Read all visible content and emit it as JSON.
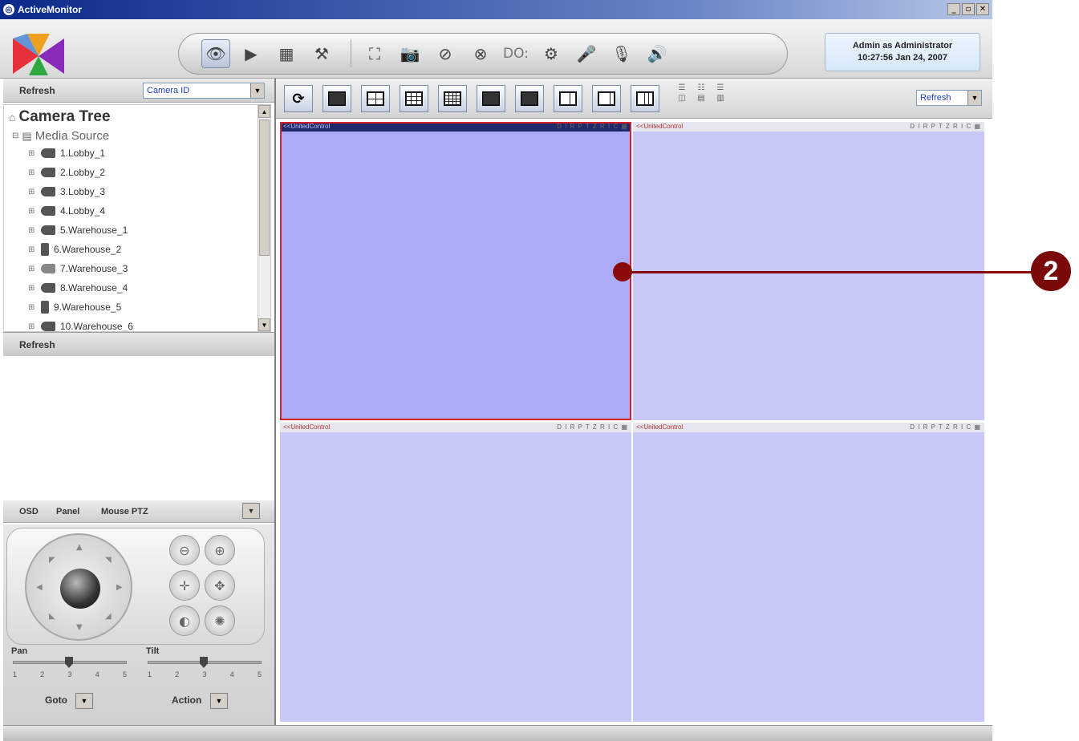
{
  "window": {
    "title": "ActiveMonitor",
    "controls": [
      "_",
      "▫",
      "✕"
    ]
  },
  "user": {
    "line1": "Admin as Administrator",
    "line2": "10:27:56 Jan 24, 2007"
  },
  "toolbar": {
    "do_label": "DO:"
  },
  "left": {
    "refresh_label": "Refresh",
    "camera_combo": "Camera ID",
    "tree_title": "Camera Tree",
    "tree_root": "Media Source",
    "cameras": [
      "1.Lobby_1",
      "2.Lobby_2",
      "3.Lobby_3",
      "4.Lobby_4",
      "5.Warehouse_1",
      "6.Warehouse_2",
      "7.Warehouse_3",
      "8.Warehouse_4",
      "9.Warehouse_5",
      "10.Warehouse_6"
    ],
    "refresh_bottom": "Refresh"
  },
  "ptz": {
    "tabs": [
      "OSD",
      "Panel",
      "Mouse PTZ"
    ],
    "pan_label": "Pan",
    "tilt_label": "Tilt",
    "ticks": [
      "1",
      "2",
      "3",
      "4",
      "5"
    ],
    "goto_label": "Goto",
    "action_label": "Action"
  },
  "main": {
    "refresh_combo": "Refresh",
    "cells": [
      {
        "title": "<<UnitedControl",
        "controls": "D I R P T Z R I C ▦",
        "active": true
      },
      {
        "title": "<<UnitedControl",
        "controls": "D I R P T Z R I C ▦",
        "active": false
      },
      {
        "title": "<<UnitedControl",
        "controls": "D I R P T Z R I C ▦",
        "active": false
      },
      {
        "title": "<<UnitedControl",
        "controls": "D I R P T Z R I C ▦",
        "active": false
      }
    ]
  },
  "callout": {
    "number": "2",
    "color": "#7a0a0a"
  },
  "colors": {
    "active_cell": "#ababf8",
    "inactive_cell": "#c9c9f9",
    "highlight": "#d8202a"
  }
}
